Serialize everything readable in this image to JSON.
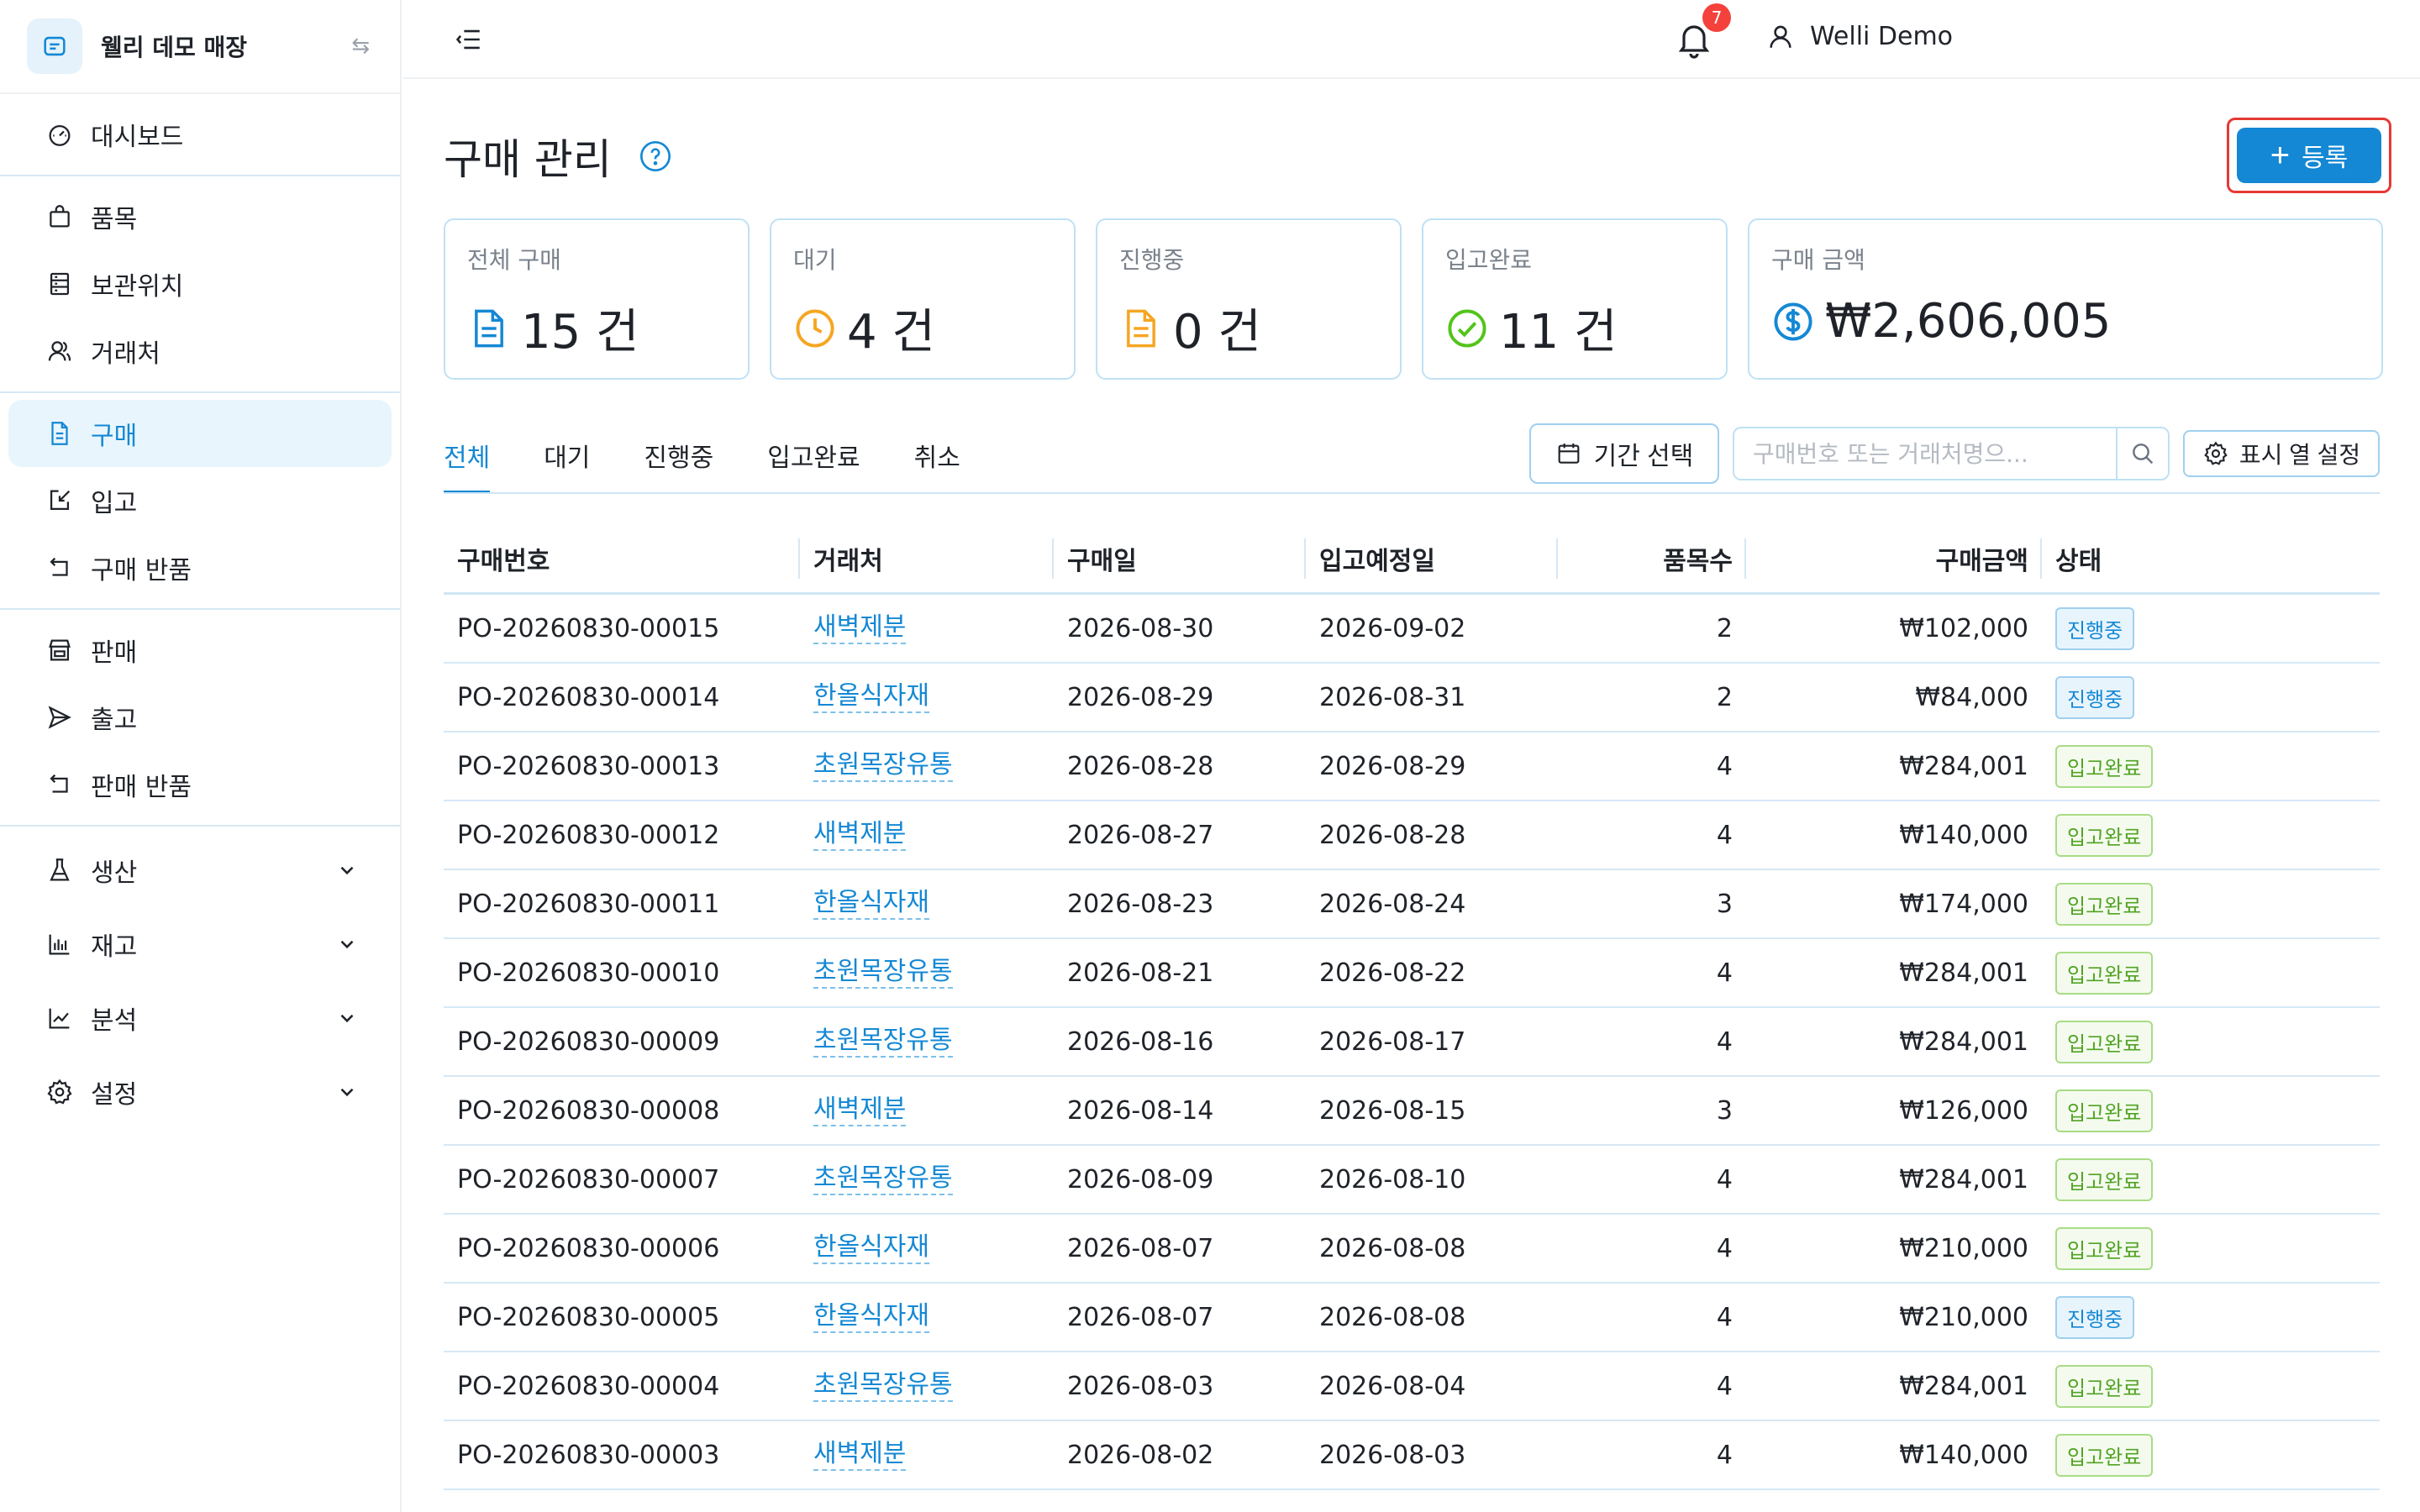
{
  "store": {
    "name": "웰리 데모 매장"
  },
  "sidebar": {
    "groups": [
      [
        {
          "label": "대시보드",
          "icon": "dashboard-icon"
        }
      ],
      [
        {
          "label": "품목",
          "icon": "bag-icon"
        },
        {
          "label": "보관위치",
          "icon": "shelf-icon"
        },
        {
          "label": "거래처",
          "icon": "users-icon"
        }
      ],
      [
        {
          "label": "구매",
          "icon": "document-icon",
          "active": true
        },
        {
          "label": "입고",
          "icon": "receive-icon"
        },
        {
          "label": "구매 반품",
          "icon": "return-icon"
        }
      ],
      [
        {
          "label": "판매",
          "icon": "shop-icon"
        },
        {
          "label": "출고",
          "icon": "send-icon"
        },
        {
          "label": "판매 반품",
          "icon": "return-icon"
        }
      ],
      [
        {
          "label": "생산",
          "icon": "flask-icon"
        },
        {
          "label": "재고",
          "icon": "bar-chart-icon"
        },
        {
          "label": "분석",
          "icon": "line-chart-icon"
        },
        {
          "label": "설정",
          "icon": "gear-icon"
        }
      ]
    ]
  },
  "header": {
    "notification_count": "7",
    "user_name": "Welli Demo"
  },
  "page": {
    "title": "구매 관리",
    "register_label": "등록"
  },
  "stats": [
    {
      "label": "전체 구매",
      "value": "15 건",
      "icon": "document-icon",
      "color": "#1488d4"
    },
    {
      "label": "대기",
      "value": "4 건",
      "icon": "clock-icon",
      "color": "#f5a623"
    },
    {
      "label": "진행중",
      "value": "0 건",
      "icon": "document-icon",
      "color": "#f5a623"
    },
    {
      "label": "입고완료",
      "value": "11 건",
      "icon": "check-circle-icon",
      "color": "#52c41a"
    },
    {
      "label": "구매 금액",
      "value": "₩2,606,005",
      "icon": "dollar-icon",
      "color": "#1488d4"
    }
  ],
  "tabs": [
    "전체",
    "대기",
    "진행중",
    "입고완료",
    "취소"
  ],
  "toolbar": {
    "date_label": "기간 선택",
    "search_placeholder": "구매번호 또는 거래처명으...",
    "columns_label": "표시 열 설정"
  },
  "table": {
    "headers": [
      "구매번호",
      "거래처",
      "구매일",
      "입고예정일",
      "품목수",
      "구매금액",
      "상태"
    ],
    "rows": [
      {
        "po": "PO-20260830-00015",
        "vendor": "새벽제분",
        "date": "2026-08-30",
        "due": "2026-09-02",
        "items": "2",
        "amount": "₩102,000",
        "status": "진행중"
      },
      {
        "po": "PO-20260830-00014",
        "vendor": "한올식자재",
        "date": "2026-08-29",
        "due": "2026-08-31",
        "items": "2",
        "amount": "₩84,000",
        "status": "진행중"
      },
      {
        "po": "PO-20260830-00013",
        "vendor": "초원목장유통",
        "date": "2026-08-28",
        "due": "2026-08-29",
        "items": "4",
        "amount": "₩284,001",
        "status": "입고완료"
      },
      {
        "po": "PO-20260830-00012",
        "vendor": "새벽제분",
        "date": "2026-08-27",
        "due": "2026-08-28",
        "items": "4",
        "amount": "₩140,000",
        "status": "입고완료"
      },
      {
        "po": "PO-20260830-00011",
        "vendor": "한올식자재",
        "date": "2026-08-23",
        "due": "2026-08-24",
        "items": "3",
        "amount": "₩174,000",
        "status": "입고완료"
      },
      {
        "po": "PO-20260830-00010",
        "vendor": "초원목장유통",
        "date": "2026-08-21",
        "due": "2026-08-22",
        "items": "4",
        "amount": "₩284,001",
        "status": "입고완료"
      },
      {
        "po": "PO-20260830-00009",
        "vendor": "초원목장유통",
        "date": "2026-08-16",
        "due": "2026-08-17",
        "items": "4",
        "amount": "₩284,001",
        "status": "입고완료"
      },
      {
        "po": "PO-20260830-00008",
        "vendor": "새벽제분",
        "date": "2026-08-14",
        "due": "2026-08-15",
        "items": "3",
        "amount": "₩126,000",
        "status": "입고완료"
      },
      {
        "po": "PO-20260830-00007",
        "vendor": "초원목장유통",
        "date": "2026-08-09",
        "due": "2026-08-10",
        "items": "4",
        "amount": "₩284,001",
        "status": "입고완료"
      },
      {
        "po": "PO-20260830-00006",
        "vendor": "한올식자재",
        "date": "2026-08-07",
        "due": "2026-08-08",
        "items": "4",
        "amount": "₩210,000",
        "status": "입고완료"
      },
      {
        "po": "PO-20260830-00005",
        "vendor": "한올식자재",
        "date": "2026-08-07",
        "due": "2026-08-08",
        "items": "4",
        "amount": "₩210,000",
        "status": "진행중"
      },
      {
        "po": "PO-20260830-00004",
        "vendor": "초원목장유통",
        "date": "2026-08-03",
        "due": "2026-08-04",
        "items": "4",
        "amount": "₩284,001",
        "status": "입고완료"
      },
      {
        "po": "PO-20260830-00003",
        "vendor": "새벽제분",
        "date": "2026-08-02",
        "due": "2026-08-03",
        "items": "4",
        "amount": "₩140,000",
        "status": "입고완료"
      }
    ]
  }
}
